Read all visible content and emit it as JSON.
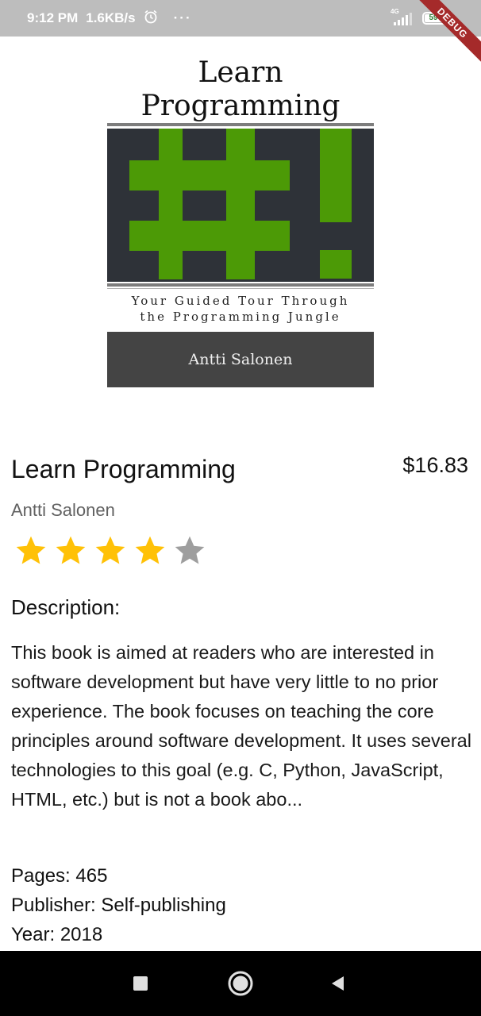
{
  "status_bar": {
    "time": "9:12 PM",
    "speed": "1.6KB/s",
    "alarm_icon": "alarm-clock-icon",
    "more_dots": "···",
    "network_label": "4G",
    "battery_level": "59",
    "debug_banner": "DEBUG"
  },
  "cover": {
    "title_line1": "Learn",
    "title_line2": "Programming",
    "art_glyphs": "#!",
    "subtitle_line1": "Your Guided Tour Through",
    "subtitle_line2": "the Programming Jungle",
    "author": "Antti Salonen",
    "art_color": "#4c9a06",
    "background_color": "#2e3238"
  },
  "book": {
    "title": "Learn Programming",
    "price": "$16.83",
    "author": "Antti Salonen",
    "rating": 4,
    "rating_max": 5,
    "description_heading": "Description:",
    "description": "This book is aimed at readers who are interested in software development but have very little to no prior experience. The book focuses on teaching the core principles around software development. It uses several technologies to this goal (e.g. C, Python, JavaScript, HTML, etc.) but is not a book abo...",
    "pages_line": "Pages: 465",
    "publisher_line": "Publisher: Self-publishing",
    "year_line": "Year: 2018"
  },
  "colors": {
    "star_filled": "#FFC107",
    "star_empty": "#9E9E9E"
  },
  "nav": {
    "recents_icon": "square-recents-icon",
    "home_icon": "circle-home-icon",
    "back_icon": "triangle-back-icon"
  }
}
